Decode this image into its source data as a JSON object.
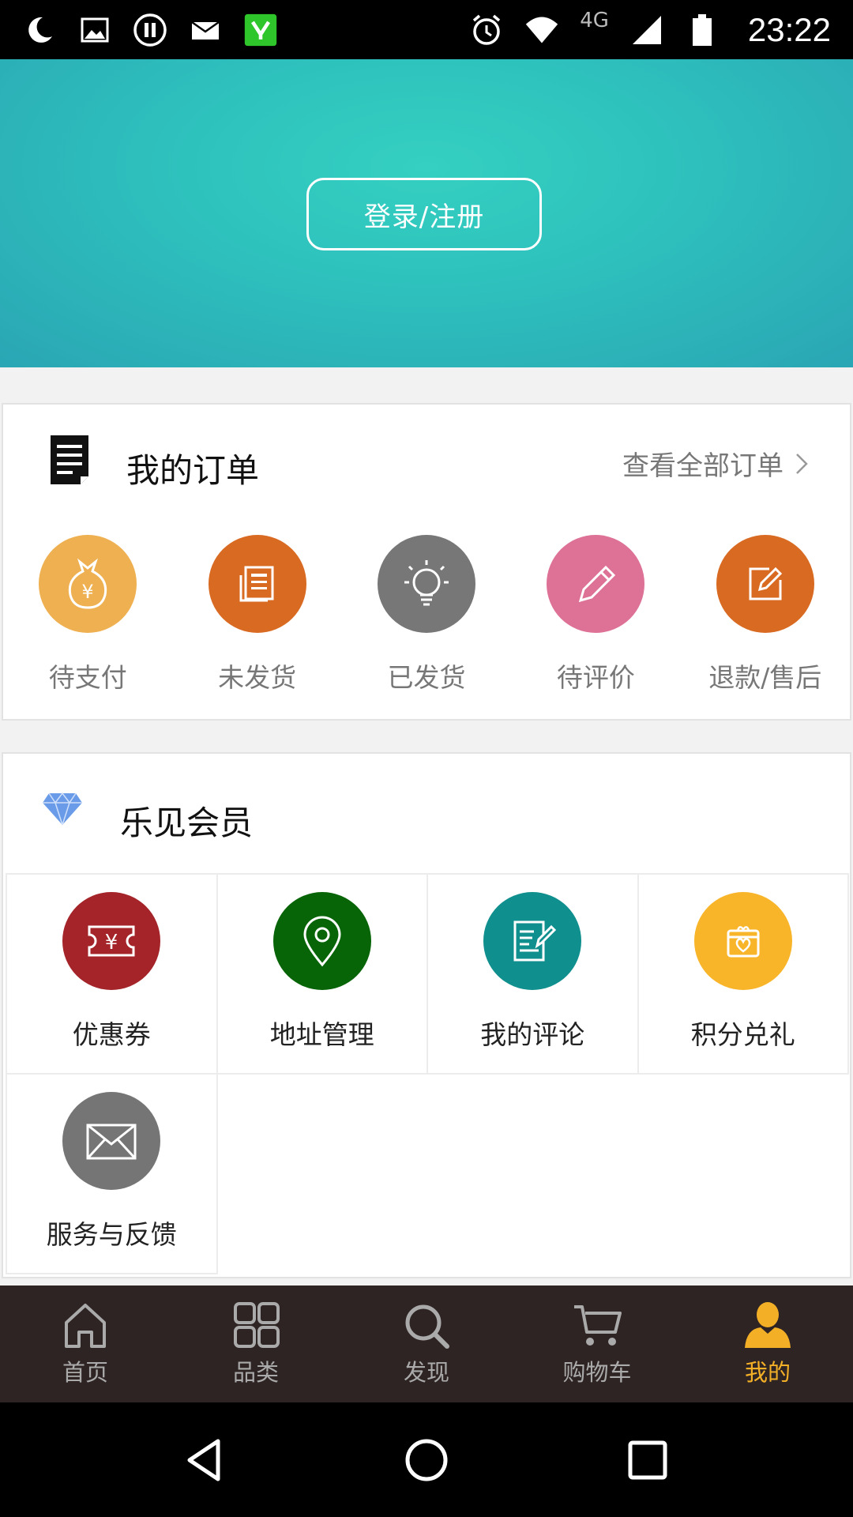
{
  "status_bar": {
    "time": "23:22",
    "network": "4G",
    "icons": [
      "moon-icon",
      "image-icon",
      "pause-icon",
      "mail-icon",
      "app-icon",
      "alarm-icon",
      "wifi-icon",
      "signal-icon",
      "battery-icon"
    ]
  },
  "hero": {
    "login_label": "登录/注册",
    "colors": {
      "gradient_center": "#35d0c1",
      "gradient_edge": "#2aa6b4"
    }
  },
  "orders": {
    "title": "我的订单",
    "view_all": "查看全部订单",
    "items": [
      {
        "label": "待支付",
        "icon": "money-bag-icon",
        "color": "#eeb050"
      },
      {
        "label": "未发货",
        "icon": "document-icon",
        "color": "#d96a22"
      },
      {
        "label": "已发货",
        "icon": "lightbulb-icon",
        "color": "#777777"
      },
      {
        "label": "待评价",
        "icon": "pencil-icon",
        "color": "#de7196"
      },
      {
        "label": "退款/售后",
        "icon": "edit-icon",
        "color": "#d96a22"
      }
    ]
  },
  "member": {
    "title": "乐见会员",
    "items": [
      {
        "label": "优惠券",
        "icon": "coupon-icon",
        "color": "#a42429"
      },
      {
        "label": "地址管理",
        "icon": "location-pin-icon",
        "color": "#076407"
      },
      {
        "label": "我的评论",
        "icon": "comment-doc-icon",
        "color": "#0f8f8d"
      },
      {
        "label": "积分兑礼",
        "icon": "gift-icon",
        "color": "#f8b52a"
      },
      {
        "label": "服务与反馈",
        "icon": "envelope-icon",
        "color": "#757575"
      }
    ]
  },
  "bottom_nav": {
    "items": [
      {
        "label": "首页",
        "icon": "home-icon"
      },
      {
        "label": "品类",
        "icon": "grid-icon"
      },
      {
        "label": "发现",
        "icon": "search-icon"
      },
      {
        "label": "购物车",
        "icon": "cart-icon"
      },
      {
        "label": "我的",
        "icon": "user-icon"
      }
    ],
    "active": "我的",
    "active_color": "#f3b027"
  }
}
